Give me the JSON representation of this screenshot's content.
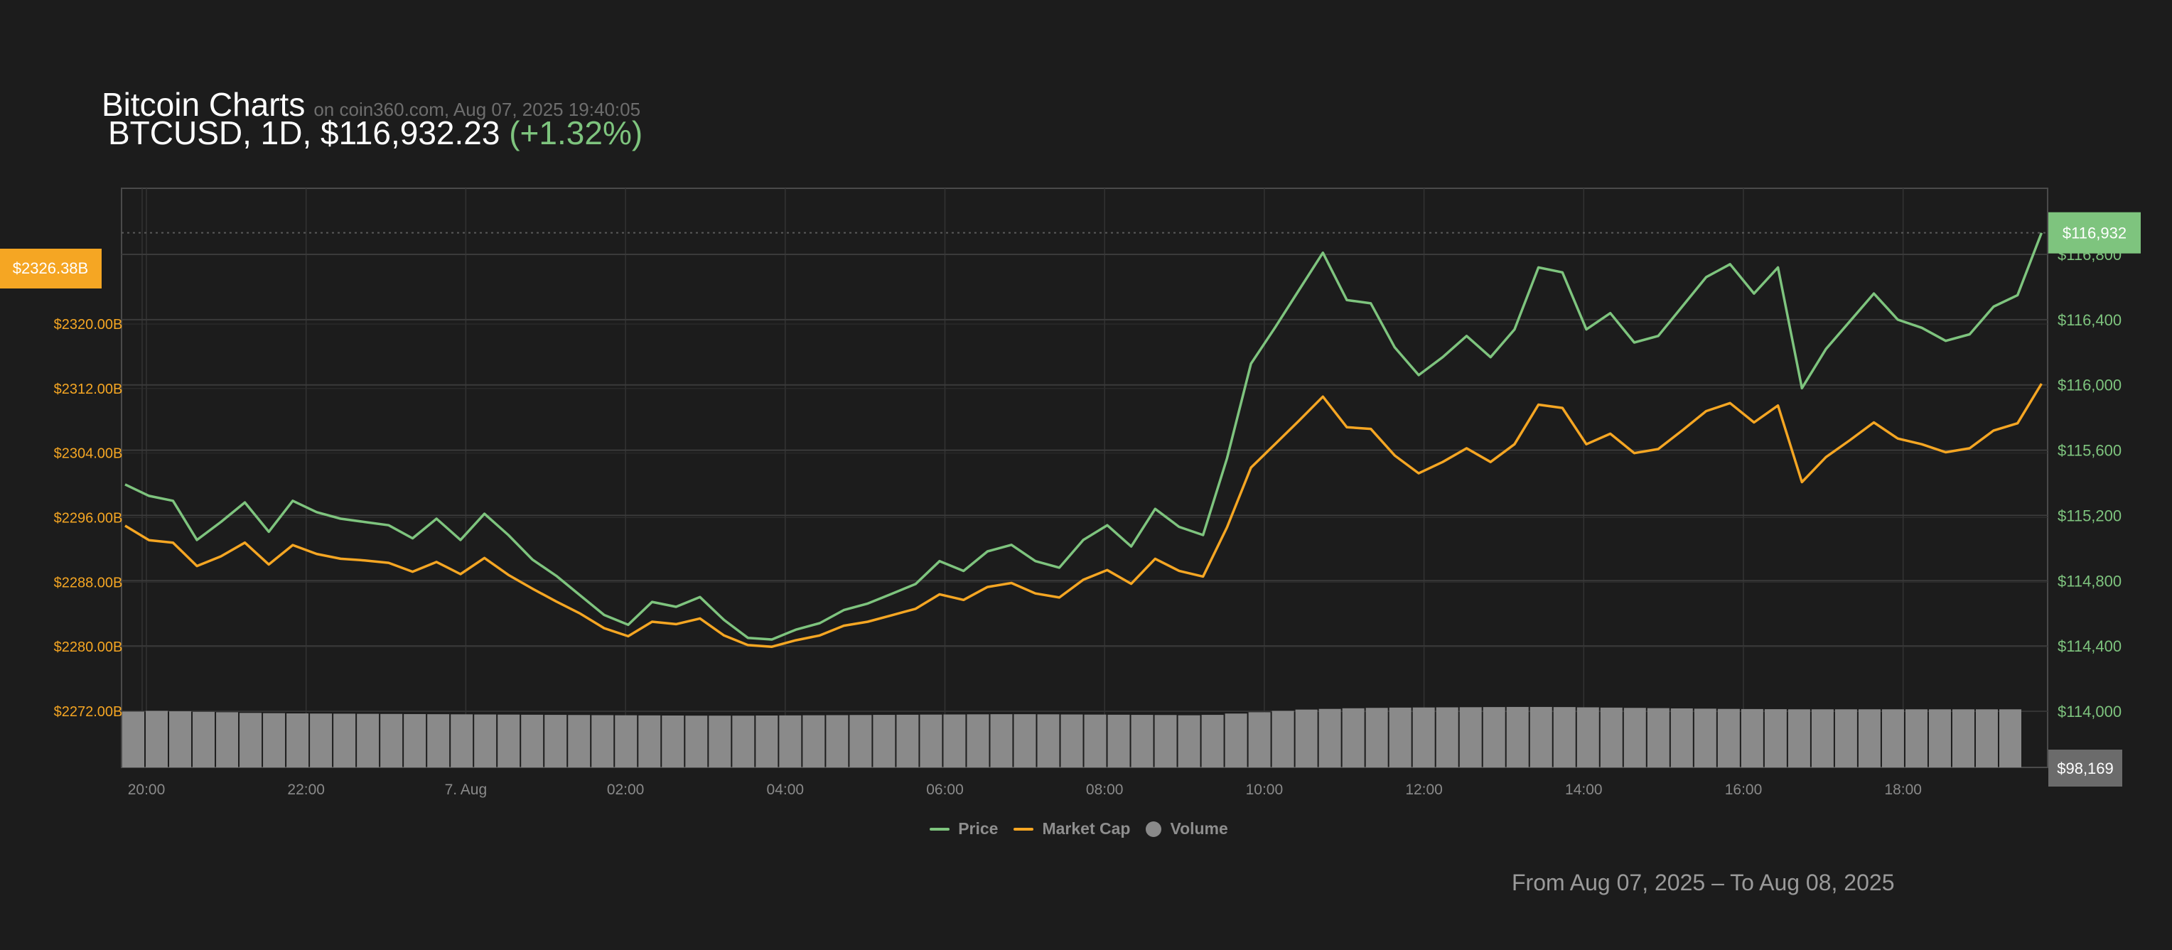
{
  "header": {
    "title": "Bitcoin Charts",
    "source": "on coin360.com, Aug 07, 2025 19:40:05",
    "pair_line": "BTCUSD, 1D, $116,932.23",
    "change": "(+1.32%)"
  },
  "range_text": "From Aug 07, 2025 – To Aug 08, 2025",
  "legend": {
    "price": "Price",
    "market_cap": "Market Cap",
    "volume": "Volume"
  },
  "colors": {
    "price": "#7ec47e",
    "market_cap": "#f5a623",
    "volume": "#8a8a8a",
    "background": "#1c1c1c"
  },
  "chart_data": {
    "type": "line",
    "x_ticks": [
      "20:00",
      "22:00",
      "7. Aug",
      "02:00",
      "04:00",
      "06:00",
      "08:00",
      "10:00",
      "12:00",
      "14:00",
      "16:00",
      "18:00"
    ],
    "left_axis": {
      "ticks": [
        "$2272.00B",
        "$2280.00B",
        "$2288.00B",
        "$2296.00B",
        "$2304.00B",
        "$2312.00B",
        "$2320.00B"
      ],
      "current_label": "$2326.38B",
      "ylim": [
        2272,
        2328
      ]
    },
    "right_axis": {
      "ticks": [
        "$114,000",
        "$114,400",
        "$114,800",
        "$115,200",
        "$115,600",
        "$116,000",
        "$116,400",
        "$116,800"
      ],
      "current_label": "$116,932",
      "ylim": [
        114000,
        117000
      ]
    },
    "volume_label": "$98,169",
    "grid": true,
    "series": [
      {
        "name": "Price",
        "axis": "right",
        "x_hours": [
          0,
          0.3,
          0.6,
          0.9,
          1.2,
          1.5,
          1.8,
          2.1,
          2.4,
          2.7,
          3.0,
          3.3,
          3.6,
          3.9,
          4.2,
          4.5,
          4.8,
          5.1,
          5.4,
          5.7,
          6.0,
          6.3,
          6.6,
          6.9,
          7.2,
          7.5,
          7.8,
          8.1,
          8.4,
          8.7,
          9.0,
          9.3,
          9.6,
          9.9,
          10.2,
          10.5,
          10.8,
          11.1,
          11.4,
          11.7,
          12.0,
          12.3,
          12.6,
          12.9,
          13.2,
          13.5,
          13.8,
          14.1,
          14.4,
          14.7,
          15.0,
          15.3,
          15.6,
          15.9,
          16.2,
          16.5,
          16.8,
          17.1,
          17.4,
          17.7,
          18.0,
          18.3,
          18.6,
          18.9,
          19.2,
          19.5,
          19.8,
          20.1,
          20.4,
          20.7,
          21.0,
          21.3,
          21.6,
          21.9,
          22.2,
          22.5,
          22.8,
          23.1,
          23.4,
          23.7,
          24.0
        ],
        "values": [
          115390,
          115320,
          115290,
          115050,
          115160,
          115280,
          115100,
          115290,
          115220,
          115180,
          115160,
          115140,
          115060,
          115180,
          115050,
          115210,
          115080,
          114930,
          114830,
          114710,
          114590,
          114530,
          114670,
          114640,
          114700,
          114560,
          114450,
          114440,
          114500,
          114540,
          114620,
          114660,
          114720,
          114780,
          114920,
          114860,
          114980,
          115020,
          114920,
          114880,
          115050,
          115140,
          115010,
          115240,
          115130,
          115080,
          115550,
          116130,
          116350,
          116580,
          116810,
          116520,
          116500,
          116230,
          116060,
          116170,
          116300,
          116170,
          116340,
          116720,
          116690,
          116340,
          116440,
          116260,
          116300,
          116480,
          116660,
          116740,
          116560,
          116720,
          115980,
          116220,
          116390,
          116560,
          116400,
          116350,
          116270,
          116310,
          116480,
          116550,
          116932
        ]
      },
      {
        "name": "Market Cap",
        "axis": "left",
        "x_hours": [
          0,
          0.3,
          0.6,
          0.9,
          1.2,
          1.5,
          1.8,
          2.1,
          2.4,
          2.7,
          3.0,
          3.3,
          3.6,
          3.9,
          4.2,
          4.5,
          4.8,
          5.1,
          5.4,
          5.7,
          6.0,
          6.3,
          6.6,
          6.9,
          7.2,
          7.5,
          7.8,
          8.1,
          8.4,
          8.7,
          9.0,
          9.3,
          9.6,
          9.9,
          10.2,
          10.5,
          10.8,
          11.1,
          11.4,
          11.7,
          12.0,
          12.3,
          12.6,
          12.9,
          13.2,
          13.5,
          13.8,
          14.1,
          14.4,
          14.7,
          15.0,
          15.3,
          15.6,
          15.9,
          16.2,
          16.5,
          16.8,
          17.1,
          17.4,
          17.7,
          18.0,
          18.3,
          18.6,
          18.9,
          19.2,
          19.5,
          19.8,
          20.1,
          20.4,
          20.7,
          21.0,
          21.3,
          21.6,
          21.9,
          22.2,
          22.5,
          22.8,
          23.1,
          23.4,
          23.7,
          24.0
        ],
        "values": [
          2295.0,
          2293.2,
          2292.9,
          2290.0,
          2291.2,
          2292.9,
          2290.2,
          2292.6,
          2291.5,
          2290.9,
          2290.7,
          2290.4,
          2289.3,
          2290.5,
          2289.0,
          2291.0,
          2288.9,
          2287.2,
          2285.6,
          2284.1,
          2282.3,
          2281.3,
          2283.1,
          2282.8,
          2283.5,
          2281.4,
          2280.2,
          2280.0,
          2280.8,
          2281.4,
          2282.6,
          2283.1,
          2283.9,
          2284.7,
          2286.5,
          2285.8,
          2287.4,
          2287.9,
          2286.6,
          2286.1,
          2288.3,
          2289.5,
          2287.8,
          2290.9,
          2289.4,
          2288.7,
          2294.8,
          2302.2,
          2305.1,
          2308.0,
          2311.0,
          2307.2,
          2307.0,
          2303.7,
          2301.5,
          2302.9,
          2304.6,
          2302.9,
          2305.1,
          2310.0,
          2309.6,
          2305.1,
          2306.4,
          2304.0,
          2304.5,
          2306.8,
          2309.2,
          2310.2,
          2307.8,
          2309.9,
          2300.4,
          2303.5,
          2305.6,
          2307.8,
          2305.8,
          2305.1,
          2304.1,
          2304.6,
          2306.8,
          2307.7,
          2312.6
        ]
      }
    ],
    "volume_values_note": "",
    "volume_values": [
      98000,
      98050,
      98020,
      97980,
      97950,
      97900,
      97880,
      97860,
      97850,
      97840,
      97830,
      97820,
      97810,
      97800,
      97790,
      97780,
      97770,
      97760,
      97750,
      97740,
      97730,
      97720,
      97710,
      97700,
      97690,
      97690,
      97690,
      97700,
      97710,
      97720,
      97730,
      97740,
      97750,
      97760,
      97770,
      97780,
      97790,
      97800,
      97800,
      97790,
      97780,
      97770,
      97760,
      97750,
      97740,
      97720,
      97750,
      97850,
      97950,
      98050,
      98150,
      98200,
      98250,
      98280,
      98300,
      98310,
      98320,
      98330,
      98340,
      98350,
      98350,
      98340,
      98320,
      98300,
      98280,
      98260,
      98240,
      98220,
      98200,
      98190,
      98180,
      98170,
      98170,
      98170,
      98170,
      98170,
      98170,
      98169,
      98169,
      98169,
      98169
    ]
  }
}
